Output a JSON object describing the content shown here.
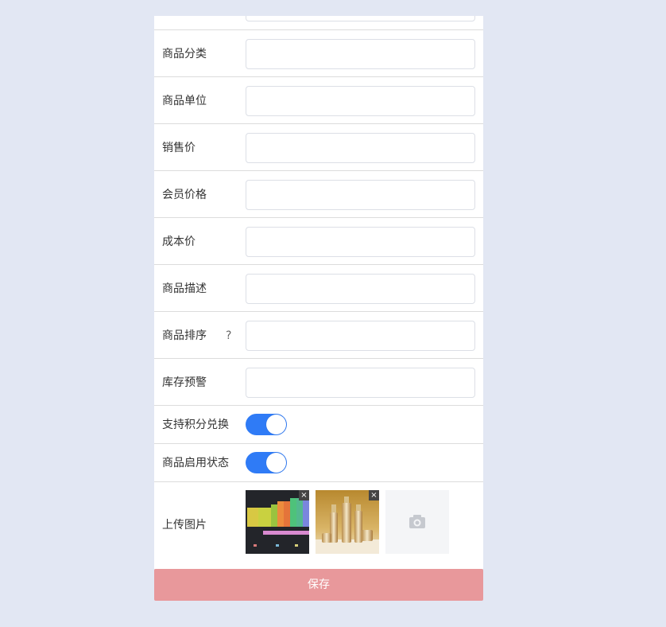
{
  "form": {
    "fields": [
      {
        "label": "商品分类",
        "value": ""
      },
      {
        "label": "商品单位",
        "value": ""
      },
      {
        "label": "销售价",
        "value": ""
      },
      {
        "label": "会员价格",
        "value": ""
      },
      {
        "label": "成本价",
        "value": ""
      },
      {
        "label": "商品描述",
        "value": ""
      },
      {
        "label": "商品排序",
        "value": "",
        "help": "?"
      },
      {
        "label": "库存预警",
        "value": ""
      }
    ],
    "toggles": [
      {
        "label": "支持积分兑换",
        "on": true
      },
      {
        "label": "商品启用状态",
        "on": true
      }
    ],
    "upload": {
      "label": "上传图片",
      "images": [
        {
          "icon": "color-chart-thumbnail",
          "remove": "×"
        },
        {
          "icon": "cosmetics-thumbnail",
          "remove": "×"
        }
      ],
      "add_icon": "camera-icon"
    }
  },
  "actions": {
    "save_label": "保存"
  },
  "colors": {
    "background": "#e2e7f3",
    "toggle_on": "#2f7bf6",
    "save_button": "#e8989b"
  }
}
